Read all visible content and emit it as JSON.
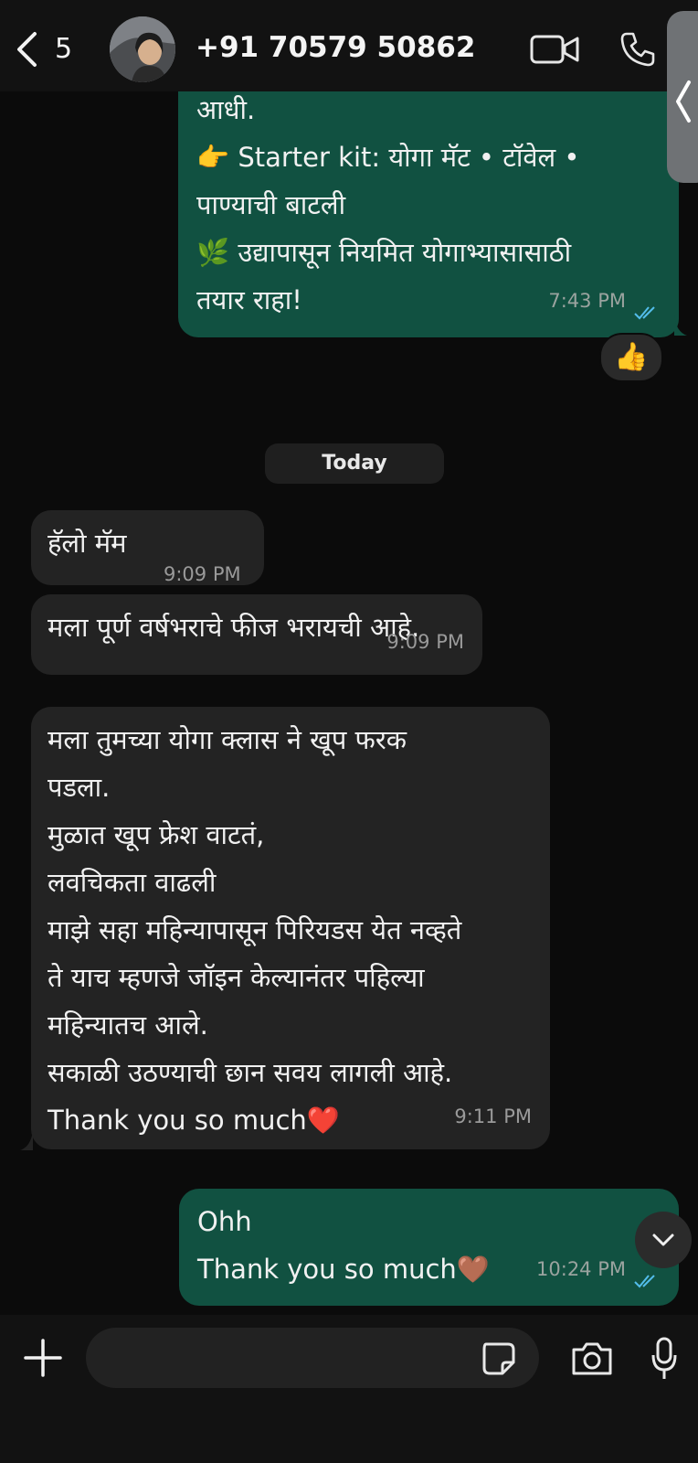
{
  "header": {
    "unread_count": "5",
    "contact_name": "+91 70579 50862",
    "icons": [
      "back-chevron-icon",
      "avatar",
      "video-call-icon",
      "phone-call-icon",
      "side-panel-chevron-icon"
    ]
  },
  "messages": [
    {
      "direction": "outgoing",
      "text": "आधी.\n👉 Starter kit: योगा मॅट • टॉवेल •\nपाण्याची बाटली\n🌿 उद्यापासून नियमित योगाभ्यासासाठी\nतयार राहा!",
      "time": "7:43 PM",
      "status": "read",
      "reaction": "👍"
    },
    {
      "direction": "incoming",
      "text": "हॅलो मॅम",
      "time": "9:09 PM"
    },
    {
      "direction": "incoming",
      "text": "मला पूर्ण वर्षभराचे फीज भरायची आहे.",
      "time": "9:09 PM"
    },
    {
      "direction": "incoming",
      "text": "मला तुमच्या योगा क्लास ने खूप फरक\nपडला.\nमुळात खूप फ्रेश वाटतं,\nलवचिकता वाढली\nमाझे सहा महिन्यापासून पिरियडस येत नव्हते\nते याच म्हणजे जॉइन केल्यानंतर पहिल्या\nमहिन्यातच आले.\nसकाळी उठण्याची छान सवय लागली आहे.\nThank you so much❤️",
      "time": "9:11 PM"
    },
    {
      "direction": "outgoing",
      "text": "Ohh\nThank you so much🤎",
      "time": "10:24 PM",
      "status": "read"
    }
  ],
  "day_separator": "Today",
  "composer": {
    "input_value": "",
    "icons": [
      "plus-icon",
      "sticker-icon",
      "camera-icon",
      "microphone-icon"
    ]
  },
  "colors": {
    "background": "#0b0b0b",
    "outgoing_bubble": "#115141",
    "incoming_bubble": "#232323",
    "read_tick": "#53bdeb"
  }
}
